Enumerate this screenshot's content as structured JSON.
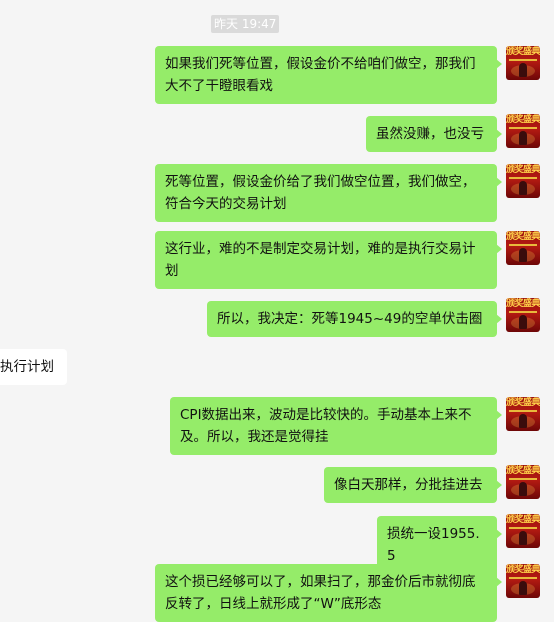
{
  "chat": {
    "timestamp": "昨天 19:47",
    "avatar_banner": "颁奖盛典",
    "messages": [
      {
        "side": "right",
        "text": "如果我们死等位置，假设金价不给咱们做空，那我们大不了干瞪眼看戏"
      },
      {
        "side": "right",
        "text": "虽然没赚，也没亏"
      },
      {
        "side": "right",
        "text": "死等位置，假设金价给了我们做空位置，我们做空，符合今天的交易计划"
      },
      {
        "side": "right",
        "text": "这行业，难的不是制定交易计划，难的是执行交易计划"
      },
      {
        "side": "right",
        "text": "所以，我决定：死等1945~49的空单伏击圈"
      },
      {
        "side": "left",
        "text": "执行计划"
      },
      {
        "side": "right",
        "text": " CPI数据出来，波动是比较快的。手动基本上来不及。所以，我还是觉得挂"
      },
      {
        "side": "right",
        "text": "像白天那样，分批挂进去"
      },
      {
        "side": "right",
        "text": "损统一设1955.5"
      },
      {
        "side": "right",
        "text": "这个损已经够可以了，如果扫了，那金价后市就彻底反转了，日线上就形成了“W”底形态"
      }
    ]
  }
}
